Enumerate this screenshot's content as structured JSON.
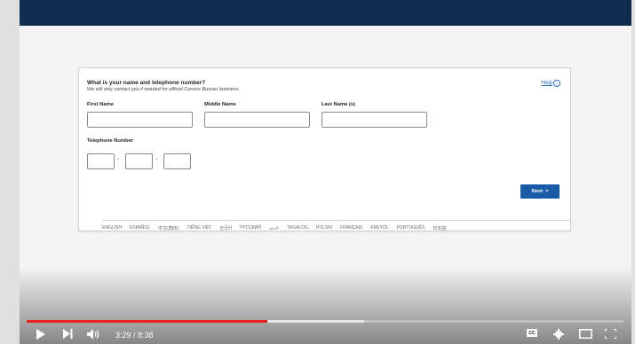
{
  "form": {
    "question": "What is your name and telephone number?",
    "subtitle": "We will only contact you if needed for official Census Bureau business.",
    "help_label": "Help",
    "help_icon_glyph": "?",
    "first_name_label": "First Name",
    "middle_name_label": "Middle Name",
    "last_name_label": "Last Name (s)",
    "telephone_label": "Telephone Number",
    "phone_separator": "-",
    "next_label": "Next",
    "next_arrow": ">",
    "next_color": "#1b5ca8"
  },
  "languages": [
    "ENGLISH",
    "ESPAÑOL",
    "中文(简体)",
    "TIẾNG VIỆT",
    "한국어",
    "РУССКИЙ",
    "عربي",
    "TAGALOG",
    "POLSKI",
    "FRANÇAIS",
    "KREYÒL",
    "PORTUGUÊS",
    "日本語"
  ],
  "player": {
    "time_display": "3:29 / 8:38",
    "played_fraction": 0.403,
    "buffered_fraction": 0.565,
    "progress_color": "#e62117",
    "cc_label": "CC",
    "icons": [
      "play-icon",
      "skip-next-icon",
      "volume-icon",
      "cc-icon",
      "gear-icon",
      "theater-mode-icon",
      "fullscreen-icon"
    ]
  },
  "header": {
    "color": "#112e51"
  }
}
